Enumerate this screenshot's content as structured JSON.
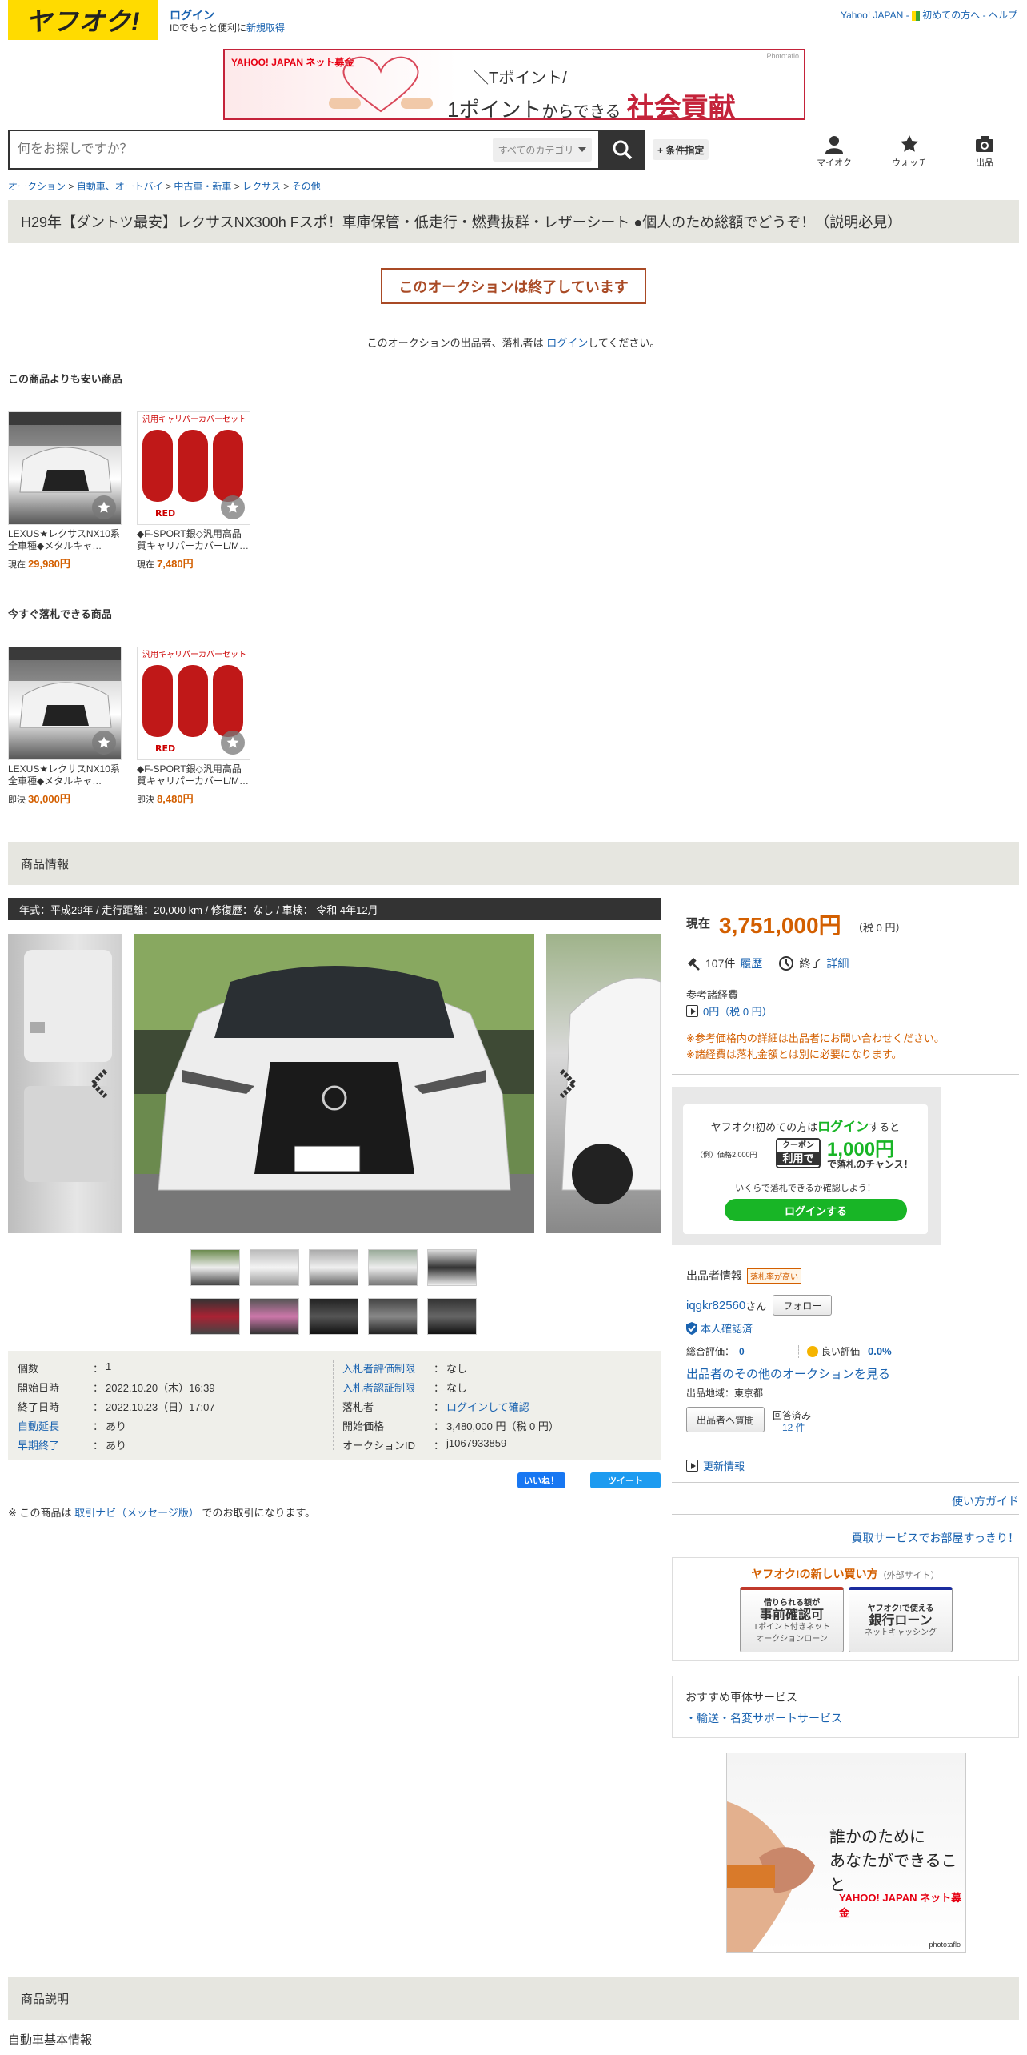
{
  "header": {
    "logo_text": "ヤフオク!",
    "login": "ログイン",
    "sub_text": "IDでもっと便利に",
    "signup": "新規取得",
    "yahoo_japan": "Yahoo! JAPAN",
    "first_time": "初めての方へ",
    "help": "ヘルプ",
    "sep": " - "
  },
  "banner": {
    "logo": "YAHOO! JAPAN ネット募金",
    "line1": "＼Tポイント/",
    "line2a": "1ポイント",
    "line2b": "からできる",
    "line2c": "社会貢献",
    "credit": "Photo:aflo"
  },
  "search": {
    "placeholder": "何をお探しですか？",
    "category": "すべてのカテゴリ",
    "conditions": "+ 条件指定"
  },
  "nav": {
    "myauction": "マイオク",
    "watch": "ウォッチ",
    "sell": "出品"
  },
  "breadcrumb": [
    "オークション",
    "自動車、オートバイ",
    "中古車・新車",
    "レクサス",
    "その他"
  ],
  "breadcrumb_sep": " > ",
  "title": "H29年【ダントツ最安】レクサスNX300h Fスポ！車庫保管・低走行・燃費抜群・レザーシート ●個人のため総額でどうぞ！（説明必見）",
  "ended": {
    "label": "このオークションは終了しています",
    "note_pre": "このオークションの出品者、落札者は ",
    "note_link": "ログイン",
    "note_post": "してください。"
  },
  "cheaper": {
    "heading": "この商品よりも安い商品",
    "items": [
      {
        "title": "LEXUS★レクサスNX10系全車種◆メタルキャ…",
        "price_label": "現在",
        "price": "29,980円"
      },
      {
        "title": "◆F-SPORT銀◇汎用高品質キャリパーカバーL/M…",
        "price_label": "現在",
        "price": "7,480円"
      }
    ]
  },
  "buynow": {
    "heading": "今すぐ落札できる商品",
    "items": [
      {
        "title": "LEXUS★レクサスNX10系全車種◆メタルキャ…",
        "price_label": "即決",
        "price": "30,000円"
      },
      {
        "title": "◆F-SPORT銀◇汎用高品質キャリパーカバーL/M…",
        "price_label": "即決",
        "price": "8,480円"
      }
    ]
  },
  "product_info_heading": "商品情報",
  "spec_bar": "年式：平成29年 / 走行距離：20,000 km / 修復歴：なし / 車検： 令和 4年12月",
  "details_left": [
    {
      "k": "個数",
      "v": "1",
      "klink": false
    },
    {
      "k": "開始日時",
      "v": "2022.10.20（木）16:39",
      "klink": false
    },
    {
      "k": "終了日時",
      "v": "2022.10.23（日）17:07",
      "klink": false
    },
    {
      "k": "自動延長",
      "v": "あり",
      "klink": true
    },
    {
      "k": "早期終了",
      "v": "あり",
      "klink": true
    }
  ],
  "details_right": [
    {
      "k": "入札者評価制限",
      "v": "なし",
      "klink": true,
      "vlink": false
    },
    {
      "k": "入札者認証制限",
      "v": "なし",
      "klink": true,
      "vlink": false
    },
    {
      "k": "落札者",
      "v": "ログインして確認",
      "klink": false,
      "vlink": true
    },
    {
      "k": "開始価格",
      "v": "3,480,000 円（税 0 円）",
      "klink": false,
      "vlink": false
    },
    {
      "k": "オークションID",
      "v": "j1067933859",
      "klink": false,
      "vlink": false
    }
  ],
  "colon": "：",
  "social": {
    "like": "いいね！",
    "tweet": "ツイート"
  },
  "note": {
    "pre": "※ この商品は ",
    "link": "取引ナビ（メッセージ版）",
    "post": " でのお取引になります。"
  },
  "price_box": {
    "label": "現在",
    "price": "3,751,000円",
    "tax": "（税 0 円）",
    "bids": "107件",
    "history": "履歴",
    "end": "終了",
    "detail": "詳細",
    "fees_label": "参考諸経費",
    "fees_value": "0円（税 0 円）",
    "warn1": "※参考価格内の詳細は出品者にお問い合わせください。",
    "warn2": "※諸経費は落札金額とは別に必要になります。"
  },
  "promo": {
    "line1a": "ヤフオク!初めての方は",
    "line1b": "ログイン",
    "line1c": "すると",
    "example": "（例）価格2,000円",
    "coupon1": "クーポン",
    "coupon2": "利用で",
    "amount": "1,000円",
    "chance": "で落札のチャンス！",
    "check": "いくらで落札できるか確認しよう！",
    "button": "ログインする"
  },
  "seller": {
    "heading": "出品者情報",
    "badge": "落札率が高い",
    "id": "iqgkr82560",
    "san": "さん",
    "follow": "フォロー",
    "verified": "本人確認済",
    "rating_label": "総合評価：",
    "rating": "0",
    "good_label": "良い評価",
    "good": "0.0%",
    "other_auctions": "出品者のその他のオークションを見る",
    "region": "出品地域：東京都",
    "ask": "出品者へ質問",
    "answered": "回答済み",
    "answered_count": "12 件",
    "updates": "更新情報"
  },
  "guide": "使い方ガイド",
  "buy_service": "買取サービスでお部屋すっきり！",
  "newbuy": {
    "heading": "ヤフオク!の新しい買い方",
    "external": "（外部サイト）",
    "c1a": "借りられる額が",
    "c1b": "事前確認可",
    "c1c": "Tポイント付きネット",
    "c1d": "オークションローン",
    "c2a": "ヤフオク!で使える",
    "c2b": "銀行ローン",
    "c2c": "ネットキャッシング"
  },
  "recommend": {
    "heading": "おすすめ車体サービス",
    "item": "・輸送・名変サポートサービス"
  },
  "side_ad": {
    "line1": "誰かのために",
    "line2": "あなたができること",
    "logo": "YAHOO! JAPAN ネット募金",
    "credit": "photo:aflo"
  },
  "description_heading": "商品説明",
  "basic_info": "自動車基本情報",
  "colors": {
    "accent": "#d35f00",
    "link": "#1a63b0",
    "yellow": "#ffdb00",
    "green": "#18b526"
  }
}
